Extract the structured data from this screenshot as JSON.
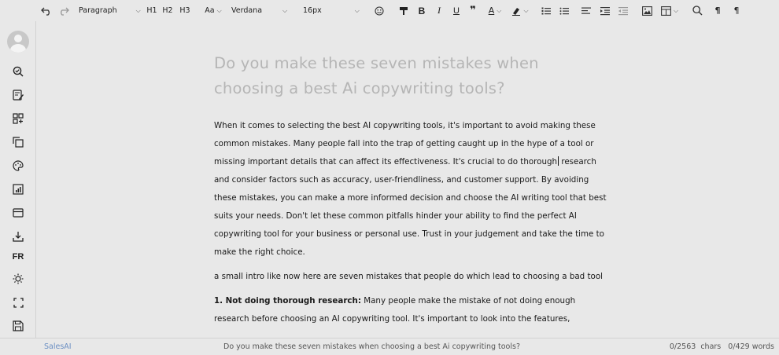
{
  "toolbar": {
    "block_format": "Paragraph",
    "h1": "H1",
    "h2": "H2",
    "h3": "H3",
    "case_label": "Aa",
    "font_family": "Verdana",
    "font_size": "16px",
    "icons": [
      "undo-icon",
      "redo-icon",
      "chevron-down-icon",
      "emoji-icon",
      "format-painter-icon",
      "bold-icon",
      "italic-icon",
      "underline-icon",
      "quote-icon",
      "text-color-icon",
      "highlight-icon",
      "ordered-list-icon",
      "bullet-list-icon",
      "align-left-icon",
      "indent-icon",
      "outdent-icon",
      "image-icon",
      "table-icon",
      "search-icon",
      "ltr-icon",
      "show-blocks-icon"
    ]
  },
  "sidebar": {
    "fr_label": "FR",
    "icons": [
      "avatar",
      "check-search-icon",
      "edit-note-icon",
      "add-block-icon",
      "copy-icon",
      "palette-icon",
      "chart-icon",
      "archive-icon",
      "download-icon",
      "brightness-icon",
      "fullscreen-icon",
      "save-icon",
      "exit-icon"
    ]
  },
  "document": {
    "title": "Do you make these seven mistakes when choosing a best Ai copywriting tools?",
    "p1_before_cursor": "When it comes to selecting the best AI copywriting tools, it's important to avoid making these common mistakes. Many people fall into the trap of getting caught up in the hype of a tool or missing important details that can affect its effectiveness. It's crucial to do thorough",
    "p1_after_cursor": " research and consider factors such as accuracy, user-friendliness, and customer support. By avoiding these mistakes, you can make a more informed decision and choose the AI writing tool that best suits your needs. Don't let these common pitfalls hinder your ability to find the perfect AI copywriting tool for your business or personal use. Trust in your judgement and take the time to make the right choice.",
    "p2": "a small intro like now here are seven mistakes that people do which lead to choosing a bad tool",
    "p3_bold": "1. Not doing thorough research:",
    "p3_rest": " Many people make the mistake of not doing enough research before choosing an AI copywriting tool. It's important to look into the features,"
  },
  "status": {
    "brand": "SalesAI",
    "document_name": "Do you make these seven mistakes when choosing a best Ai copywriting tools?",
    "counts": "0/2563  chars   0/429 words"
  },
  "colors": {
    "background": "#e8e8e8",
    "title": "#b5b5b5",
    "brand": "#6b8fc3"
  }
}
